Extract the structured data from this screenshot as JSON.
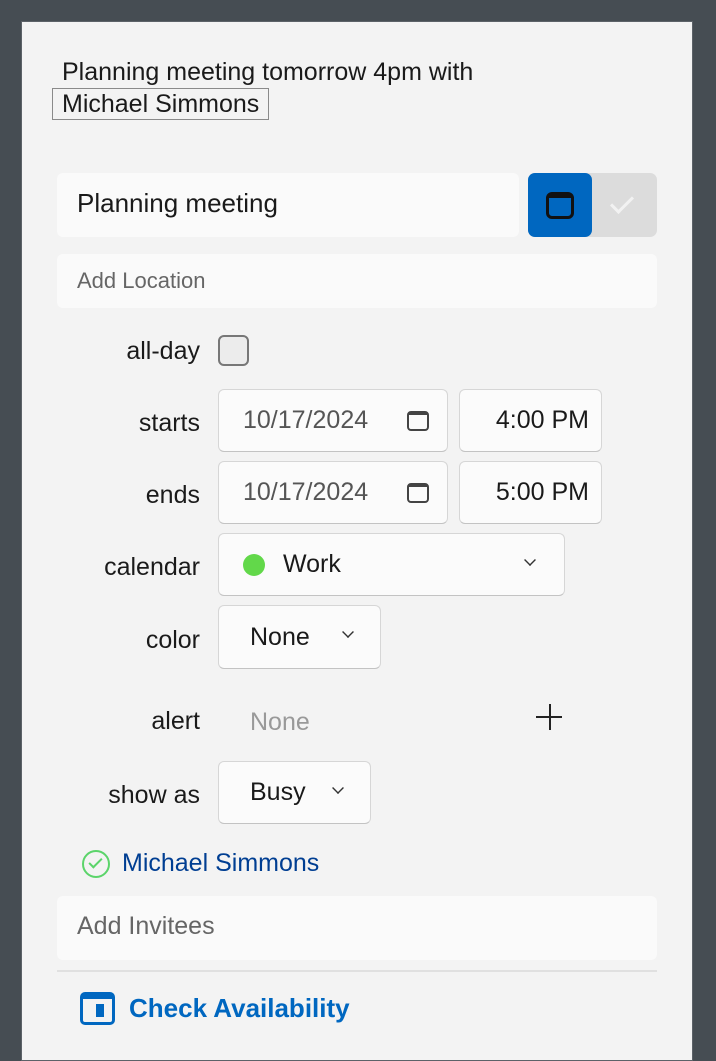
{
  "natural_language_input": {
    "text": "Planning meeting tomorrow 4pm with",
    "chip": "Michael Simmons"
  },
  "title_field": {
    "value": "Planning meeting"
  },
  "mode_toggle": {
    "selected": "event",
    "accent": "#0067c0"
  },
  "location_field": {
    "placeholder": "Add Location"
  },
  "all_day": {
    "label": "all-day",
    "checked": false
  },
  "starts": {
    "label": "starts",
    "date": "10/17/2024",
    "time": "4:00 PM"
  },
  "ends": {
    "label": "ends",
    "date": "10/17/2024",
    "time": "5:00 PM"
  },
  "calendar": {
    "label": "calendar",
    "value": "Work",
    "color": "#62d84a"
  },
  "color": {
    "label": "color",
    "value": "None"
  },
  "alert": {
    "label": "alert",
    "value": "None"
  },
  "show_as": {
    "label": "show as",
    "value": "Busy"
  },
  "invitee": {
    "name": "Michael Simmons",
    "status": "accepted"
  },
  "invitees_field": {
    "placeholder": "Add Invitees"
  },
  "check_availability": {
    "label": "Check Availability"
  }
}
